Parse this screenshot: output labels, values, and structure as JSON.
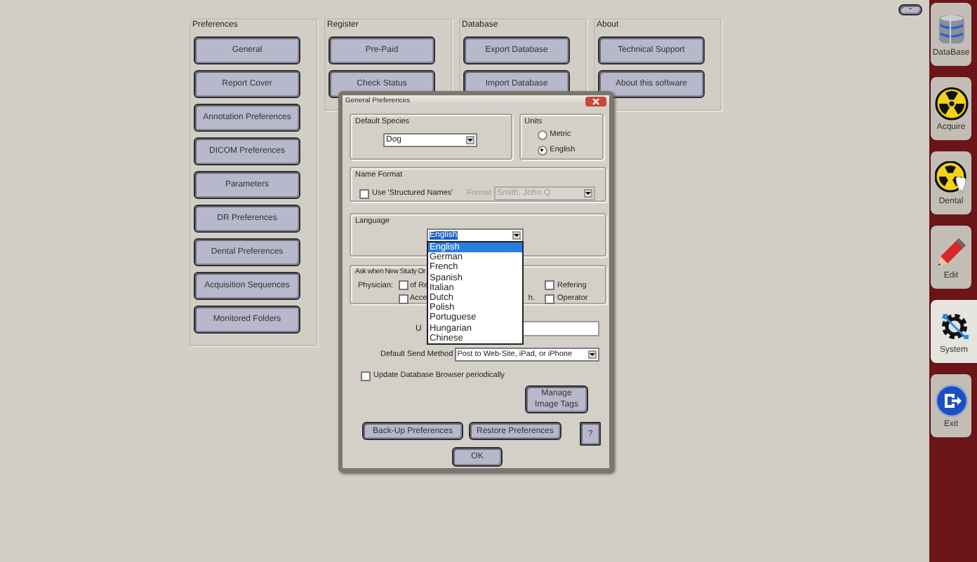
{
  "minimize_button": "-",
  "groups": [
    {
      "title": "Preferences",
      "buttons": [
        "General",
        "Report Cover",
        "Annotation Preferences",
        "DICOM Preferences",
        "Parameters",
        "DR Preferences",
        "Dental Preferences",
        "Acquisition Sequences",
        "Monitored Folders"
      ]
    },
    {
      "title": "Register",
      "buttons": [
        "Pre-Paid",
        "Check Status"
      ]
    },
    {
      "title": "Database",
      "buttons": [
        "Export Database",
        "Import Database"
      ]
    },
    {
      "title": "About",
      "buttons": [
        "Technical Support",
        "About this software"
      ]
    }
  ],
  "sidebar": {
    "tabs": [
      {
        "label": "DataBase",
        "kind": "database",
        "selected": false
      },
      {
        "label": "Acquire",
        "kind": "radiation",
        "selected": false
      },
      {
        "label": "Dental",
        "kind": "dental",
        "selected": false
      },
      {
        "label": "Edit",
        "kind": "pencil",
        "selected": false
      },
      {
        "label": "System",
        "kind": "tools",
        "selected": true
      },
      {
        "label": "Exit",
        "kind": "exit",
        "selected": false
      }
    ]
  },
  "dialog": {
    "title": "General Preferences",
    "species": {
      "title": "Default Species",
      "value": "Dog"
    },
    "units": {
      "title": "Units",
      "options": [
        {
          "label": "Metric",
          "selected": false
        },
        {
          "label": "English",
          "selected": true
        }
      ]
    },
    "name_format": {
      "title": "Name Format",
      "checkbox": {
        "label": "Use 'Structured Names'",
        "checked": false
      },
      "format_label": "Format",
      "format_value": "Smith, John Q",
      "disabled": true
    },
    "language": {
      "title": "Language",
      "value": "English",
      "options": [
        {
          "label": "English",
          "selected": true
        },
        {
          "label": "German",
          "selected": false
        },
        {
          "label": "French",
          "selected": false
        },
        {
          "label": "Spanish",
          "selected": false
        },
        {
          "label": "Italian",
          "selected": false
        },
        {
          "label": "Dutch",
          "selected": false
        },
        {
          "label": "Polish",
          "selected": false
        },
        {
          "label": "Portuguese",
          "selected": false
        },
        {
          "label": "Hungarian",
          "selected": false
        },
        {
          "label": "Chinese",
          "selected": false
        }
      ]
    },
    "ask": {
      "title": "Ask when New Study Or",
      "physician_label": "Physician:",
      "row_1": [
        {
          "label": "of Re",
          "checked": false
        },
        {
          "label": "Refering",
          "checked": false
        }
      ],
      "row_2": [
        {
          "label": "Acce",
          "checked": false
        },
        {
          "label": "Operator",
          "checked": false
        }
      ],
      "fragment": "h."
    },
    "u_label": "U",
    "send_method": {
      "label": "Default Send Method",
      "value": "Post to Web-Site, iPad, or iPhone"
    },
    "update_checkbox": {
      "label": "Update Database Browser periodically",
      "checked": false
    },
    "manage_button": "Manage Image Tags",
    "backup_button": "Back-Up Preferences",
    "restore_button": "Restore Preferences",
    "help_button": "?",
    "ok_button": "OK"
  }
}
